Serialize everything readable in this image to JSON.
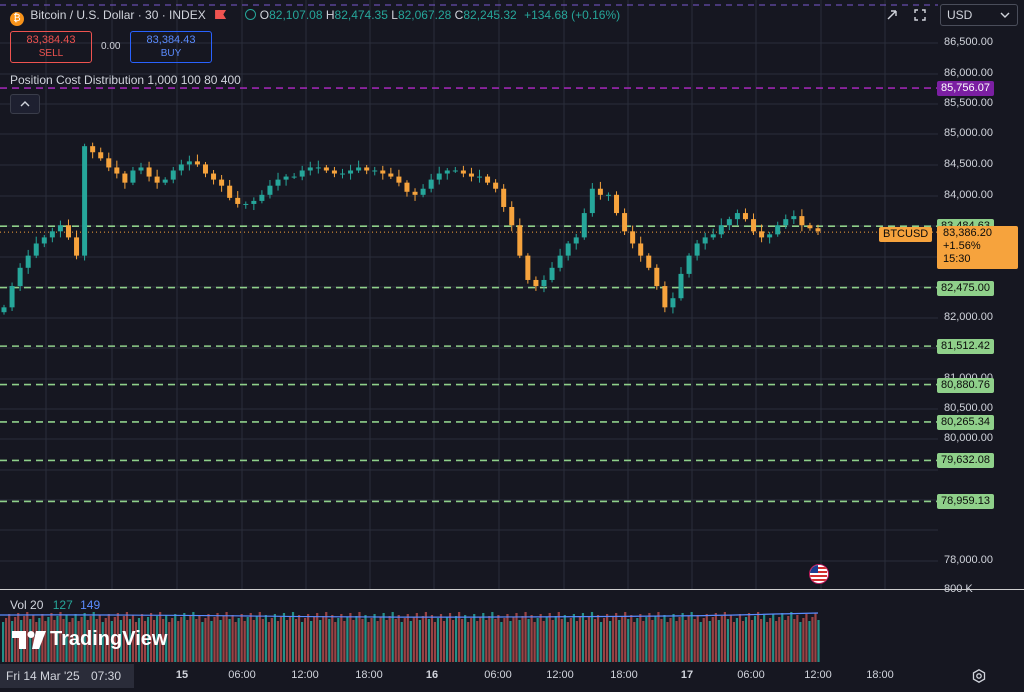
{
  "header": {
    "symbol": "Bitcoin / U.S. Dollar · 30 · INDEX",
    "open_label": "O",
    "open": "82,107.08",
    "high_label": "H",
    "high": "82,474.35",
    "low_label": "L",
    "low": "82,067.28",
    "close_label": "C",
    "close": "82,245.32",
    "change": "+134.68 (+0.16%)",
    "bitcoin_icon": "bitcoin-icon",
    "flag_icon": "flag-icon"
  },
  "trade": {
    "sell_price": "83,384.43",
    "sell_label": "SELL",
    "spread": "0.00",
    "buy_price": "83,384.43",
    "buy_label": "BUY"
  },
  "indicator": {
    "position_cost": "Position Cost Distribution 1,000 100 80 400"
  },
  "currency": "USD",
  "price_axis": {
    "labels": [
      "86,500.00",
      "86,000.00",
      "85,500.00",
      "85,000.00",
      "84,500.00",
      "84,000.00",
      "82,000.00",
      "81,000.00",
      "80,500.00",
      "80,000.00",
      "78,000.00",
      "800 K"
    ],
    "tags": [
      {
        "value": "85,756.07",
        "kind": "purple"
      },
      {
        "value": "83,484.63",
        "kind": "green"
      },
      {
        "value": "82,475.00",
        "kind": "green"
      },
      {
        "value": "81,512.42",
        "kind": "green"
      },
      {
        "value": "80,880.76",
        "kind": "green"
      },
      {
        "value": "80,265.34",
        "kind": "green"
      },
      {
        "value": "79,632.08",
        "kind": "green"
      },
      {
        "value": "78,959.13",
        "kind": "green"
      }
    ],
    "current": {
      "symbol": "BTCUSD",
      "price": "83,386.20",
      "change": "+1.56%",
      "countdown": "15:30"
    }
  },
  "volume": {
    "label": "Vol 20",
    "value1": "127",
    "value2": "149"
  },
  "time_axis": {
    "labels": [
      "15",
      "06:00",
      "12:00",
      "18:00",
      "16",
      "06:00",
      "12:00",
      "18:00",
      "17",
      "06:00",
      "12:00",
      "18:00"
    ],
    "crosshair_date": "Fri 14 Mar '25",
    "crosshair_time": "07:30"
  },
  "brand": "TradingView",
  "colors": {
    "up": "#26a69a",
    "down": "#ef5350",
    "orange": "#f6a33d",
    "green_line": "#8fd08a",
    "purple_line": "#9c27b0",
    "accent_blue": "#2962ff"
  },
  "chart_data": {
    "type": "candlestick",
    "title": "Bitcoin / U.S. Dollar · 30 · INDEX",
    "ylim": [
      77500,
      86900
    ],
    "horizontal_levels": [
      85756.07,
      83484.63,
      82475.0,
      81512.42,
      80880.76,
      80265.34,
      79632.08,
      78959.13
    ],
    "current_price": 83386.2,
    "close_path": [
      82150,
      82500,
      82800,
      83000,
      83200,
      83300,
      83400,
      83500,
      83300,
      83000,
      84800,
      84700,
      84600,
      84450,
      84350,
      84200,
      84400,
      84450,
      84300,
      84200,
      84250,
      84400,
      84500,
      84550,
      84500,
      84350,
      84250,
      84150,
      83950,
      83850,
      83850,
      83900,
      84000,
      84150,
      84250,
      84300,
      84300,
      84400,
      84450,
      84450,
      84400,
      84350,
      84350,
      84400,
      84450,
      84400,
      84400,
      84350,
      84300,
      84200,
      84050,
      84000,
      84100,
      84250,
      84350,
      84400,
      84400,
      84350,
      84300,
      84300,
      84200,
      84100,
      83800,
      83500,
      83000,
      82600,
      82500,
      82600,
      82800,
      83000,
      83200,
      83300,
      83700,
      84100,
      84000,
      84000,
      83700,
      83400,
      83200,
      83000,
      82800,
      82500,
      82150,
      82300,
      82700,
      83000,
      83200,
      83300,
      83350,
      83500,
      83600,
      83700,
      83600,
      83400,
      83300,
      83350,
      83500,
      83600,
      83650,
      83500,
      83450,
      83400
    ]
  }
}
